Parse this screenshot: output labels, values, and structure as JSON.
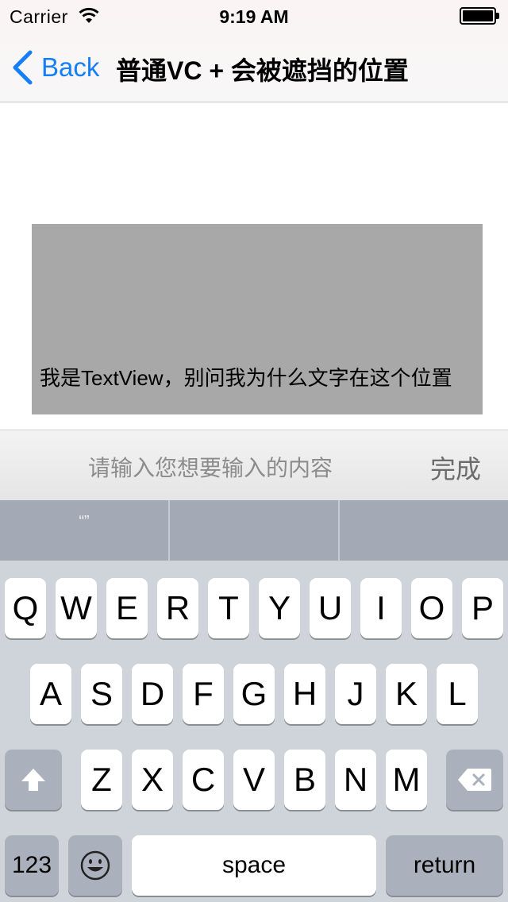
{
  "status_bar": {
    "carrier": "Carrier",
    "time": "9:19 AM"
  },
  "nav_bar": {
    "back_label": "Back",
    "title": "普通VC + 会被遮挡的位置"
  },
  "content": {
    "textview_text": "我是TextView，别问我为什么文字在这个位置"
  },
  "accessory_bar": {
    "placeholder": "请输入您想要输入的内容",
    "done_label": "完成"
  },
  "keyboard": {
    "suggestions": [
      "“”",
      "",
      ""
    ],
    "row1": [
      "Q",
      "W",
      "E",
      "R",
      "T",
      "Y",
      "U",
      "I",
      "O",
      "P"
    ],
    "row2": [
      "A",
      "S",
      "D",
      "F",
      "G",
      "H",
      "J",
      "K",
      "L"
    ],
    "row3": [
      "Z",
      "X",
      "C",
      "V",
      "B",
      "N",
      "M"
    ],
    "numbers_label": "123",
    "space_label": "space",
    "return_label": "return",
    "icons": [
      "shift-icon",
      "delete-icon",
      "emoji-icon"
    ]
  },
  "colors": {
    "accent": "#157efb",
    "gray_box": "#a8a8a8",
    "keyboard_bg": "#cfd3da"
  }
}
